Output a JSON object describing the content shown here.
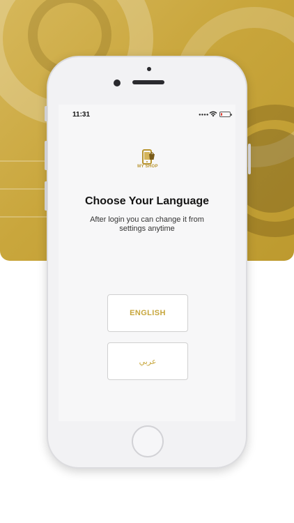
{
  "status_bar": {
    "time": "11:31",
    "signal_icon": "signal-dots-icon",
    "wifi_icon": "wifi-icon",
    "battery_icon": "battery-low-icon",
    "battery_level": 0.15,
    "battery_color": "#e23b30"
  },
  "brand": {
    "logo_icon": "shopping-phone-logo-icon",
    "name": "MY SHOP",
    "accent_color": "#c7a63c"
  },
  "language_screen": {
    "title": "Choose Your Language",
    "subtitle": "After login you can change it from settings anytime",
    "options": [
      {
        "label": "ENGLISH"
      },
      {
        "label": "عربي"
      }
    ]
  }
}
